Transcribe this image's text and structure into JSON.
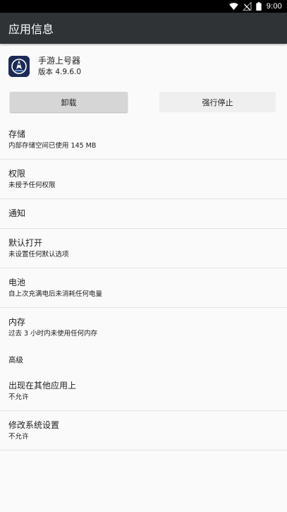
{
  "status_bar": {
    "time": "9:00",
    "icons": [
      "wifi-icon",
      "signal-icon",
      "battery-icon"
    ]
  },
  "toolbar": {
    "title": "应用信息"
  },
  "app": {
    "name": "手游上号器",
    "version": "版本 4.9.6.0",
    "icon": "app-logo-icon"
  },
  "buttons": {
    "uninstall": "卸载",
    "force_stop": "强行停止"
  },
  "settings": {
    "storage": {
      "title": "存储",
      "summary": "内部存储空间已使用 145 MB"
    },
    "permissions": {
      "title": "权限",
      "summary": "未授予任何权限"
    },
    "notifications": {
      "title": "通知"
    },
    "open_by_default": {
      "title": "默认打开",
      "summary": "未设置任何默认选项"
    },
    "battery": {
      "title": "电池",
      "summary": "自上次充满电后未消耗任何电量"
    },
    "memory": {
      "title": "内存",
      "summary": "过去 3 小时内未使用任何内存"
    },
    "advanced_header": "高级",
    "draw_over": {
      "title": "出现在其他应用上",
      "summary": "不允许"
    },
    "modify_system": {
      "title": "修改系统设置",
      "summary": "不允许"
    }
  },
  "colors": {
    "toolbar_bg": "#2f3336",
    "status_bar_bg": "#000000",
    "background": "#fafafa",
    "divider": "#e3e3e3"
  }
}
